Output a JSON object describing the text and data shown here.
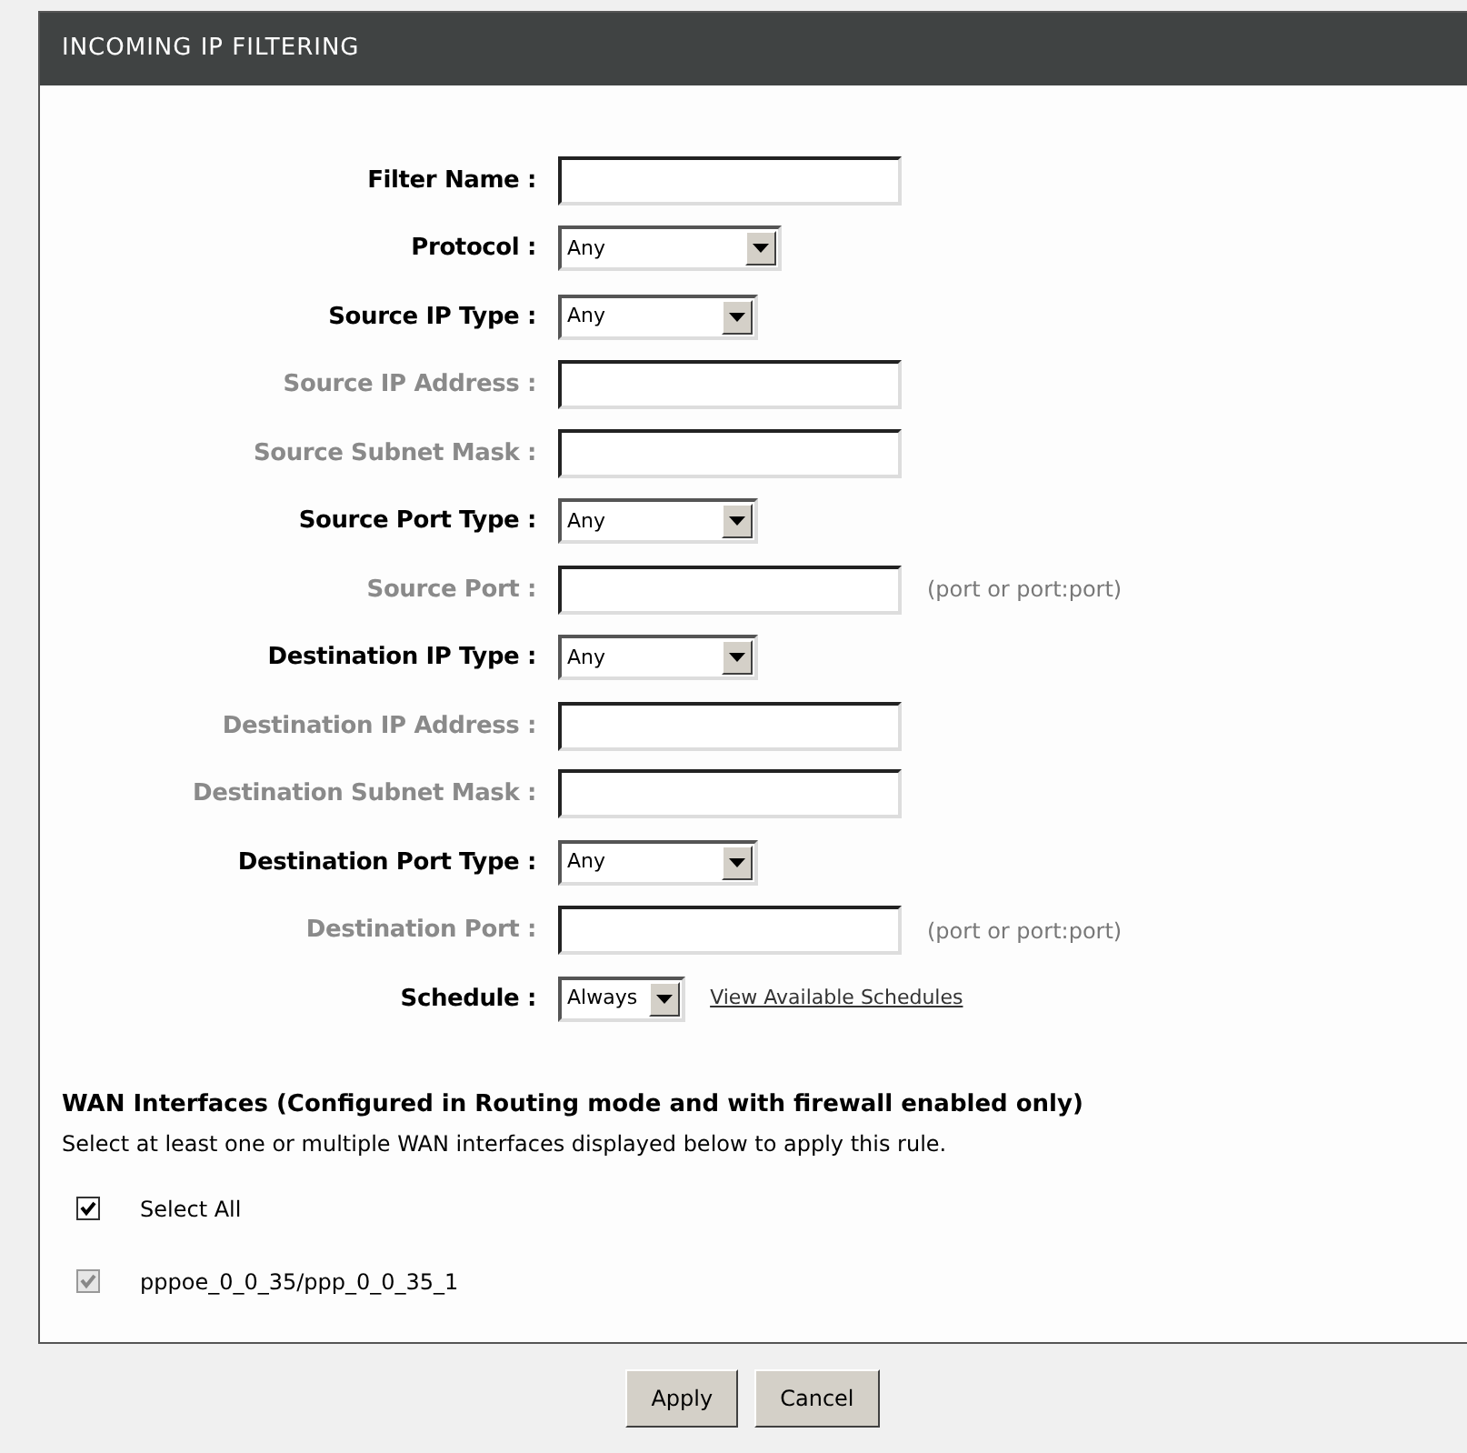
{
  "section": {
    "title": "INCOMING IP FILTERING"
  },
  "fields": [
    {
      "label": "Filter Name :",
      "kind": "text",
      "disabled": false
    },
    {
      "label": "Protocol :",
      "kind": "select",
      "value": "Any",
      "disabled": false
    },
    {
      "label": "Source IP Type :",
      "kind": "select",
      "value": "Any",
      "disabled": false
    },
    {
      "label": "Source IP Address :",
      "kind": "text",
      "disabled": true
    },
    {
      "label": "Source Subnet Mask :",
      "kind": "text",
      "disabled": true
    },
    {
      "label": "Source Port Type :",
      "kind": "select",
      "value": "Any",
      "disabled": false
    },
    {
      "label": "Source Port :",
      "kind": "text",
      "disabled": true,
      "hint": "(port or port:port)"
    },
    {
      "label": "Destination IP Type :",
      "kind": "select",
      "value": "Any",
      "disabled": false
    },
    {
      "label": "Destination IP Address :",
      "kind": "text",
      "disabled": true
    },
    {
      "label": "Destination Subnet Mask :",
      "kind": "text",
      "disabled": true
    },
    {
      "label": "Destination Port Type :",
      "kind": "select",
      "value": "Any",
      "disabled": false
    },
    {
      "label": "Destination Port :",
      "kind": "text",
      "disabled": true,
      "hint": "(port or port:port)"
    },
    {
      "label": "Schedule :",
      "kind": "select",
      "value": "Always",
      "disabled": false,
      "link": "View Available Schedules"
    }
  ],
  "wan": {
    "heading": "WAN Interfaces (Configured in Routing mode and with firewall enabled only)",
    "description": "Select at least one or multiple WAN interfaces displayed below to apply this rule.",
    "interfaces": [
      {
        "label": "Select All",
        "checked": true,
        "disabled": false
      },
      {
        "label": "pppoe_0_0_35/ppp_0_0_35_1",
        "checked": true,
        "disabled": true
      }
    ]
  },
  "buttons": [
    "Apply",
    "Cancel"
  ]
}
